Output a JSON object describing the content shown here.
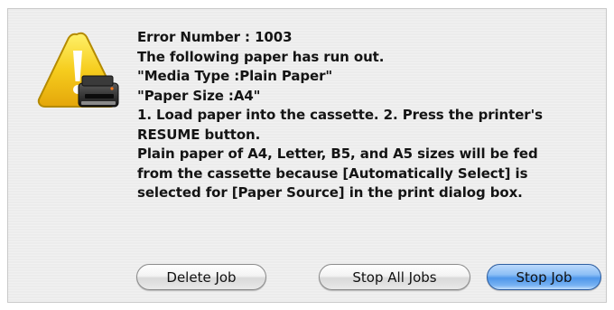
{
  "dialog": {
    "icon": "printer-caution-icon",
    "message_lines": [
      "Error Number : 1003",
      "The following paper has run out.",
      "\"Media Type :Plain Paper\"",
      "\"Paper Size :A4\"",
      "1. Load paper into the cassette. 2. Press the printer's",
      "RESUME button.",
      "Plain paper of A4, Letter, B5, and A5 sizes will be fed",
      "from the cassette because [Automatically Select] is",
      "selected for [Paper Source] in the print dialog box."
    ],
    "buttons": {
      "delete_job": "Delete Job",
      "stop_all_jobs": "Stop All Jobs",
      "stop_job": "Stop Job"
    },
    "colors": {
      "default_button": "#6aa8f0",
      "warning_triangle": "#f5c518"
    }
  }
}
